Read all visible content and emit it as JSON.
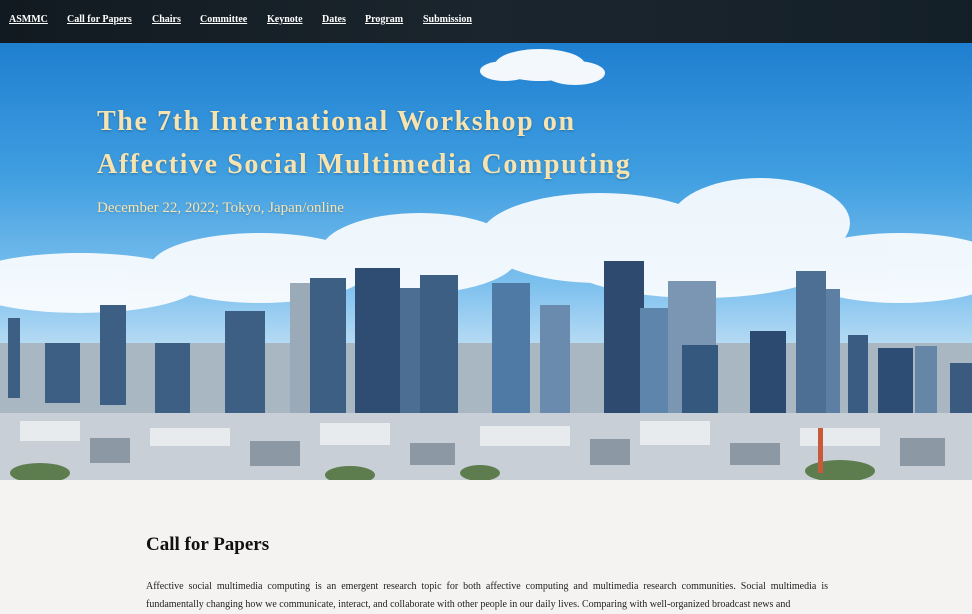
{
  "nav": {
    "brand": "ASMMC",
    "items": [
      "Call for Papers",
      "Chairs",
      "Committee",
      "Keynote",
      "Dates",
      "Program",
      "Submission"
    ]
  },
  "hero": {
    "title_line1": "The 7th International Workshop on",
    "title_line2": "Affective Social Multimedia Computing",
    "subtitle": "December 22, 2022; Tokyo, Japan/online"
  },
  "cfp": {
    "heading": "Call for Papers",
    "paragraph": "Affective social multimedia computing is an emergent research topic for both affective computing and multimedia research communities. Social multimedia is fundamentally changing how we communicate, interact, and collaborate with other people in our daily lives. Comparing with well-organized broadcast news and"
  },
  "colors": {
    "nav_bg": "#161f27",
    "title_color": "#f6e3b0",
    "page_bg": "#f4f3f1"
  }
}
